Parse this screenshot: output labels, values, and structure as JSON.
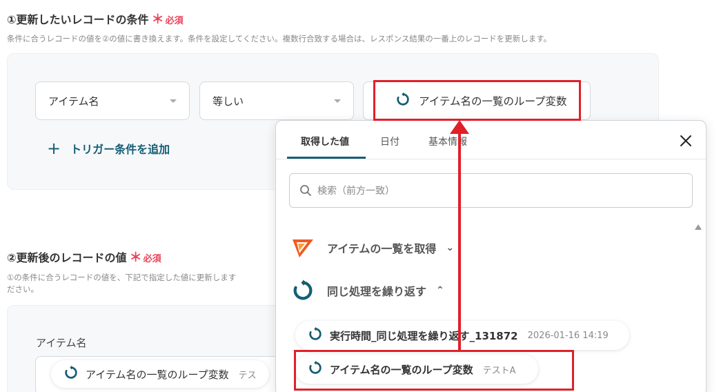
{
  "section1": {
    "title": "①更新したいレコードの条件",
    "required_mark": "＊",
    "required_text": "必須",
    "description": "条件に合うレコードの値を②の値に書き換えます。条件を設定してください。複数行合致する場合は、レスポンス結果の一番上のレコードを更新します。",
    "field_select": "アイテム名",
    "operator_select": "等しい",
    "value_chip": "アイテム名の一覧のループ変数",
    "add_condition": "トリガー条件を追加"
  },
  "section2": {
    "title": "②更新後のレコードの値",
    "required_mark": "＊",
    "required_text": "必須",
    "description_line1": "①の条件に合うレコードの値を、下記で指定した値に更新します",
    "description_line2": "ださい。",
    "field_label": "アイテム名",
    "field_chip_label": "アイテム名の一覧のループ変数",
    "field_chip_value": "テス"
  },
  "popup": {
    "tabs": [
      "取得した値",
      "日付",
      "基本情報"
    ],
    "search_placeholder": "検索（前方一致）",
    "groups": [
      {
        "label": "アイテムの一覧を取得",
        "expanded": false
      },
      {
        "label": "同じ処理を繰り返す",
        "expanded": true
      }
    ],
    "items": [
      {
        "label": "実行時間_同じ処理を繰り返す_131872",
        "value": "2026-01-16 14:19"
      },
      {
        "label": "アイテム名の一覧のループ変数",
        "value": "テストA"
      }
    ]
  },
  "colors": {
    "accent_teal": "#155e75",
    "required_red": "#e8445a",
    "highlight_red": "#e02028",
    "panel_bg": "#f7f8fa"
  }
}
